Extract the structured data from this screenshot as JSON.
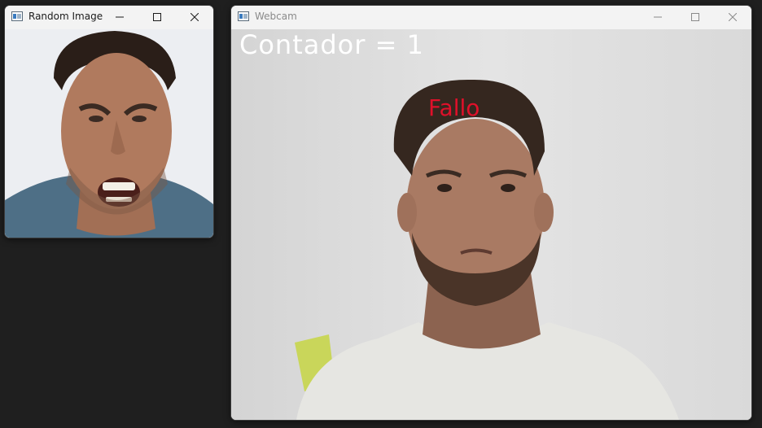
{
  "windows": {
    "random_image": {
      "title": "Random Image",
      "icon": "opencv-window-icon"
    },
    "webcam": {
      "title": "Webcam",
      "icon": "opencv-window-icon",
      "overlay": {
        "counter": "Contador = 1",
        "result": "Fallo"
      }
    }
  },
  "controls": [
    "minimize-icon",
    "maximize-icon",
    "close-icon"
  ],
  "colors": {
    "desktop": "#1f1f1f",
    "titlebar": "#f3f3f3",
    "counter_text": "#ffffff",
    "result_text": "#e0102a"
  }
}
